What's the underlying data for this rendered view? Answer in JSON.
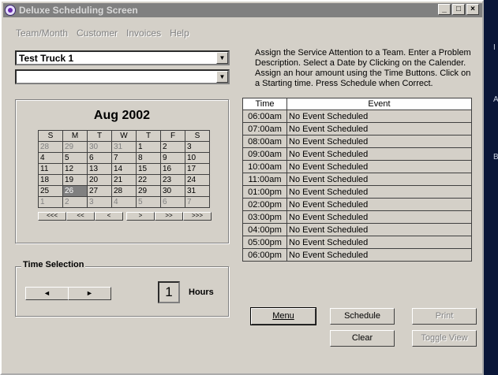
{
  "window": {
    "title": "Deluxe Scheduling Screen"
  },
  "edge_letters": [
    "I",
    "A",
    "B"
  ],
  "menu": [
    "Team/Month",
    "Customer",
    "Invoices",
    "Help"
  ],
  "team_select": {
    "value": "Test Truck 1"
  },
  "problem_select": {
    "value": ""
  },
  "calendar": {
    "title": "Aug 2002",
    "days": [
      "S",
      "M",
      "T",
      "W",
      "T",
      "F",
      "S"
    ],
    "weeks": [
      [
        {
          "d": "28",
          "o": true
        },
        {
          "d": "29",
          "o": true
        },
        {
          "d": "30",
          "o": true
        },
        {
          "d": "31",
          "o": true
        },
        {
          "d": "1"
        },
        {
          "d": "2"
        },
        {
          "d": "3"
        }
      ],
      [
        {
          "d": "4"
        },
        {
          "d": "5"
        },
        {
          "d": "6"
        },
        {
          "d": "7"
        },
        {
          "d": "8"
        },
        {
          "d": "9"
        },
        {
          "d": "10"
        }
      ],
      [
        {
          "d": "11"
        },
        {
          "d": "12"
        },
        {
          "d": "13"
        },
        {
          "d": "14"
        },
        {
          "d": "15"
        },
        {
          "d": "16"
        },
        {
          "d": "17"
        }
      ],
      [
        {
          "d": "18"
        },
        {
          "d": "19"
        },
        {
          "d": "20"
        },
        {
          "d": "21"
        },
        {
          "d": "22"
        },
        {
          "d": "23"
        },
        {
          "d": "24"
        }
      ],
      [
        {
          "d": "25"
        },
        {
          "d": "26",
          "s": true
        },
        {
          "d": "27"
        },
        {
          "d": "28"
        },
        {
          "d": "29"
        },
        {
          "d": "30"
        },
        {
          "d": "31"
        }
      ],
      [
        {
          "d": "1",
          "o": true
        },
        {
          "d": "2",
          "o": true
        },
        {
          "d": "3",
          "o": true
        },
        {
          "d": "4",
          "o": true
        },
        {
          "d": "5",
          "o": true
        },
        {
          "d": "6",
          "o": true
        },
        {
          "d": "7",
          "o": true
        }
      ]
    ],
    "nav": [
      "<<<",
      "<<",
      "<",
      ">",
      ">>",
      ">>>"
    ]
  },
  "time_selection": {
    "label": "Time Selection",
    "prev": "◄",
    "next": "►",
    "hours_value": "1",
    "hours_label": "Hours"
  },
  "instructions": "Assign the Service Attention to a Team. Enter a Problem Description. Select a Date by Clicking on the Calender. Assign an hour amount using the Time Buttons.  Click on a Starting time.  Press Schedule when Correct.",
  "schedule": {
    "headers": [
      "Time",
      "Event"
    ],
    "rows": [
      {
        "time": "06:00am",
        "event": "No Event Scheduled"
      },
      {
        "time": "07:00am",
        "event": "No Event Scheduled"
      },
      {
        "time": "08:00am",
        "event": "No Event Scheduled"
      },
      {
        "time": "09:00am",
        "event": "No Event Scheduled"
      },
      {
        "time": "10:00am",
        "event": "No Event Scheduled"
      },
      {
        "time": "11:00am",
        "event": "No Event Scheduled"
      },
      {
        "time": "01:00pm",
        "event": "No Event Scheduled"
      },
      {
        "time": "02:00pm",
        "event": "No Event Scheduled"
      },
      {
        "time": "03:00pm",
        "event": "No Event Scheduled"
      },
      {
        "time": "04:00pm",
        "event": "No Event Scheduled"
      },
      {
        "time": "05:00pm",
        "event": "No Event Scheduled"
      },
      {
        "time": "06:00pm",
        "event": "No Event Scheduled"
      }
    ]
  },
  "buttons": {
    "menu": "Menu",
    "schedule": "Schedule",
    "print": "Print",
    "clear": "Clear",
    "toggle_view": "Toggle View"
  },
  "title_buttons": {
    "minimize": "_",
    "maximize": "□",
    "close": "×"
  },
  "combo_arrow": "▼"
}
